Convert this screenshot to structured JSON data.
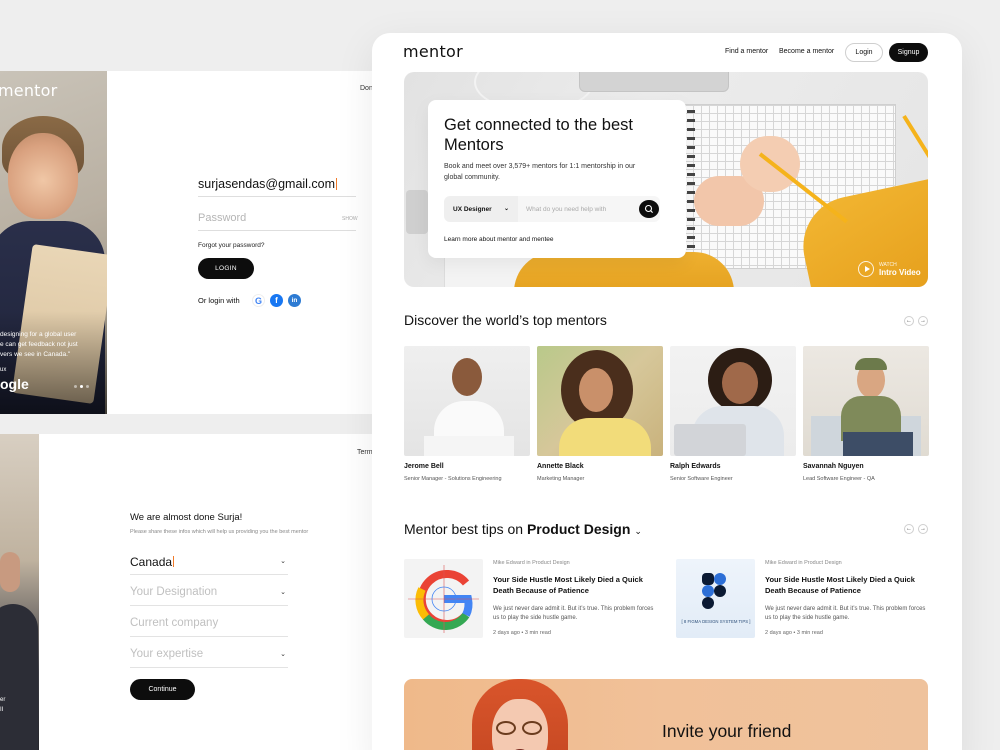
{
  "login_screen": {
    "logo": "mentor",
    "top_right_text": "Don",
    "quote_lines": [
      "designing for a global user",
      "e can get feedback not just",
      "vers we see in Canada.\""
    ],
    "quote_by": "ux",
    "brand": "ogle",
    "email_value": "surjasendas@gmail.com",
    "password_placeholder": "Password",
    "show_label": "SHOW",
    "forgot_label": "Forgot your password?",
    "login_button": "LOGIN",
    "or_login_with": "Or login with",
    "social_icons": [
      "google-icon",
      "facebook-icon",
      "linkedin-icon"
    ]
  },
  "onboarding_screen": {
    "terms_text": "Term",
    "side_text_1": "er",
    "side_text_2": "II",
    "title": "We are almost done Surja!",
    "subtitle": "Please share these infos which will help us providing you the best mentor",
    "country_value": "Canada",
    "designation_placeholder": "Your Designation",
    "company_placeholder": "Current company",
    "expertise_placeholder": "Your expertise",
    "continue_button": "Continue"
  },
  "landing": {
    "logo": "mentor",
    "nav": {
      "find_mentor": "Find a mentor",
      "become_mentor": "Become a mentor",
      "login": "Login",
      "signup": "Signup"
    },
    "hero": {
      "title": "Get connected to the best Mentors",
      "description": "Book and meet over 3,579+ mentors for 1:1 mentorship in our global community.",
      "select_value": "UX Designer",
      "search_placeholder": "What do you need help with",
      "learn_more": "Learn more about mentor and mentee",
      "watch_small": "WATCH",
      "watch_big": "Intro Video"
    },
    "mentors_section": {
      "title": "Discover the world’s top mentors",
      "mentors": [
        {
          "name": "Jerome Bell",
          "role": "Senior Manager - Solutions Engineering"
        },
        {
          "name": "Annette Black",
          "role": "Marketing Manager"
        },
        {
          "name": "Ralph Edwards",
          "role": "Senior Software Engineer"
        },
        {
          "name": "Savannah Nguyen",
          "role": "Lead Software Engineer - QA"
        }
      ]
    },
    "tips_section": {
      "title_prefix": "Mentor best tips on",
      "title_topic": "Product Design",
      "tips": [
        {
          "author": "Mike Edward in Product Design",
          "title": "Your Side Hustle Most Likely Died a Quick Death Because of Patience",
          "excerpt": "We just never dare admit it. But it’s true. This problem forces us to play the side hustle game.",
          "meta": "2 days ago  •  3 min read"
        },
        {
          "author": "Mike Edward in Product Design",
          "title": "Your Side Hustle Most Likely Died a Quick Death Because of Patience",
          "excerpt": "We just never dare admit it. But it’s true. This problem forces us to play the side hustle game.",
          "meta": "2 days ago  •  3 min read",
          "thumb_caption": "[ 8 FIGMA DESIGN SYSTEM TIPS ]"
        }
      ]
    },
    "invite": {
      "title": "Invite your friend"
    },
    "colors": {
      "accent_caret": "#f07b2b",
      "button_dark": "#0d0d0d",
      "hero_orange": "#f2b632",
      "invite_bg": "#efb98a"
    }
  }
}
